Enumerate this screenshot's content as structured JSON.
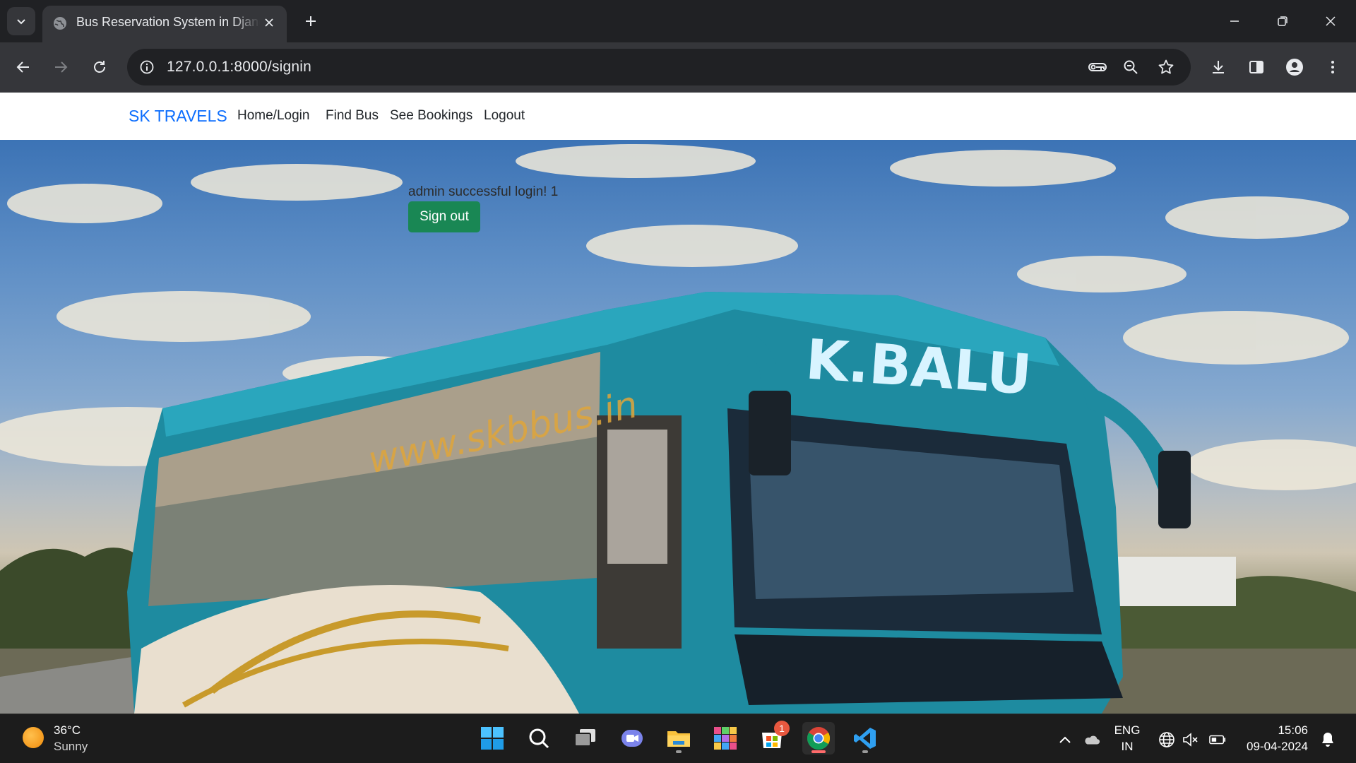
{
  "browser": {
    "tab": {
      "title": "Bus Reservation System in Django"
    },
    "address_bar": {
      "url": "127.0.0.1:8000/signin"
    }
  },
  "navbar": {
    "brand": "SK TRAVELS",
    "links": [
      {
        "label": "Home/Login"
      },
      {
        "label": "Find Bus"
      },
      {
        "label": "See Bookings"
      },
      {
        "label": "Logout"
      }
    ]
  },
  "content": {
    "message": "admin successful login! 1",
    "signout_label": "Sign out"
  },
  "hero_image": {
    "bus_name_text": "K.BALU",
    "bus_site_text": "www.skbbus.in"
  },
  "taskbar": {
    "weather": {
      "temp": "36°C",
      "condition": "Sunny"
    },
    "store_badge": "1",
    "language": {
      "line1": "ENG",
      "line2": "IN"
    },
    "clock": {
      "time": "15:06",
      "date": "09-04-2024"
    }
  },
  "colors": {
    "brand": "#0d6efd",
    "signout_button": "#198754",
    "chrome_dark": "#202124",
    "chrome_toolbar": "#35363a"
  }
}
